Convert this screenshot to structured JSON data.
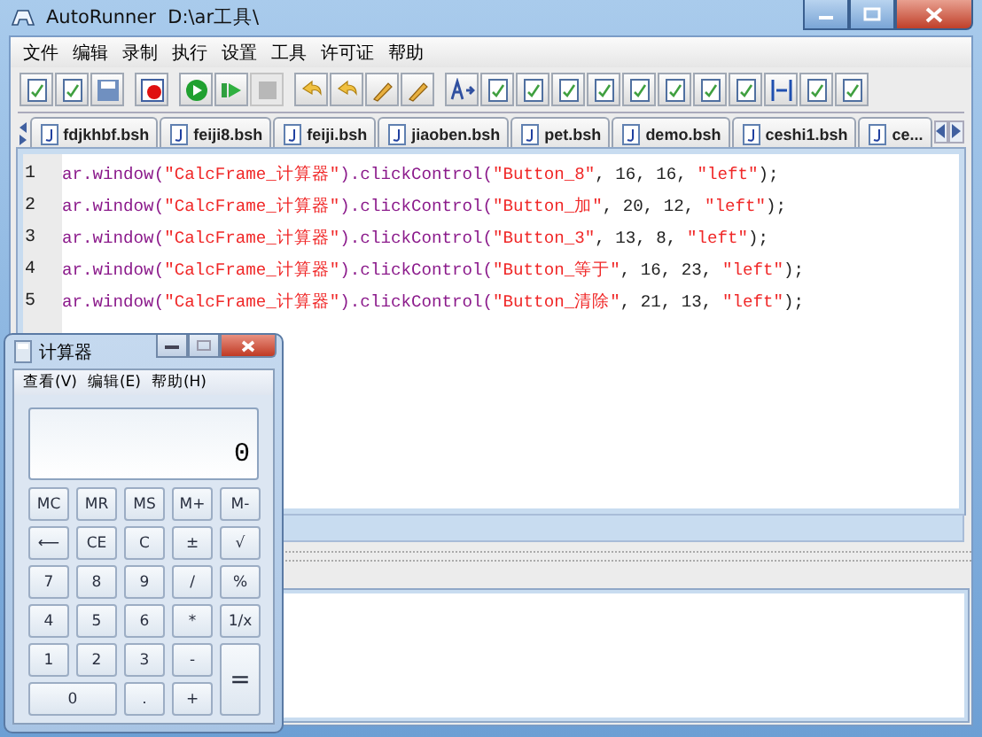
{
  "window": {
    "title": "AutoRunner  D:\\ar工具\\"
  },
  "menu": [
    "文件",
    "编辑",
    "录制",
    "执行",
    "设置",
    "工具",
    "许可证",
    "帮助"
  ],
  "toolbar": [
    {
      "buttons": [
        {
          "disabled": false
        },
        {
          "disabled": false
        },
        {
          "disabled": false
        }
      ]
    },
    {
      "buttons": [
        {
          "disabled": false
        }
      ]
    },
    {
      "buttons": [
        {
          "disabled": false
        },
        {
          "disabled": false
        },
        {
          "disabled": true
        }
      ]
    },
    {
      "buttons": [
        {
          "disabled": false
        },
        {
          "disabled": false
        },
        {
          "disabled": false
        },
        {
          "disabled": false
        }
      ]
    },
    {
      "buttons": [
        {
          "disabled": false
        },
        {
          "disabled": false
        },
        {
          "disabled": false
        },
        {
          "disabled": false
        },
        {
          "disabled": false
        },
        {
          "disabled": false
        },
        {
          "disabled": false
        },
        {
          "disabled": false
        },
        {
          "disabled": false
        },
        {
          "disabled": false
        },
        {
          "disabled": false
        },
        {
          "disabled": false
        }
      ]
    }
  ],
  "tabs": [
    "fdjkhbf.bsh",
    "feiji8.bsh",
    "feiji.bsh",
    "jiaoben.bsh",
    "pet.bsh",
    "demo.bsh",
    "ceshi1.bsh",
    "ce..."
  ],
  "editor": {
    "lines": [
      {
        "number": "1",
        "segments": [
          {
            "kind": "call",
            "text": "ar.window("
          },
          {
            "kind": "string",
            "text": "\"CalcFrame_计算器\""
          },
          {
            "kind": "call",
            "text": ").clickControl("
          },
          {
            "kind": "string",
            "text": "\"Button_8\""
          },
          {
            "kind": "plain",
            "text": ", 16, 16, "
          },
          {
            "kind": "string",
            "text": "\"left\""
          },
          {
            "kind": "plain",
            "text": ");"
          }
        ]
      },
      {
        "number": "2",
        "segments": [
          {
            "kind": "call",
            "text": "ar.window("
          },
          {
            "kind": "string",
            "text": "\"CalcFrame_计算器\""
          },
          {
            "kind": "call",
            "text": ").clickControl("
          },
          {
            "kind": "string",
            "text": "\"Button_加\""
          },
          {
            "kind": "plain",
            "text": ", 20, 12, "
          },
          {
            "kind": "string",
            "text": "\"left\""
          },
          {
            "kind": "plain",
            "text": ");"
          }
        ]
      },
      {
        "number": "3",
        "segments": [
          {
            "kind": "call",
            "text": "ar.window("
          },
          {
            "kind": "string",
            "text": "\"CalcFrame_计算器\""
          },
          {
            "kind": "call",
            "text": ").clickControl("
          },
          {
            "kind": "string",
            "text": "\"Button_3\""
          },
          {
            "kind": "plain",
            "text": ", 13, 8, "
          },
          {
            "kind": "string",
            "text": "\"left\""
          },
          {
            "kind": "plain",
            "text": ");"
          }
        ]
      },
      {
        "number": "4",
        "segments": [
          {
            "kind": "call",
            "text": "ar.window("
          },
          {
            "kind": "string",
            "text": "\"CalcFrame_计算器\""
          },
          {
            "kind": "call",
            "text": ").clickControl("
          },
          {
            "kind": "string",
            "text": "\"Button_等于\""
          },
          {
            "kind": "plain",
            "text": ", 16, 23, "
          },
          {
            "kind": "string",
            "text": "\"left\""
          },
          {
            "kind": "plain",
            "text": ");"
          }
        ]
      },
      {
        "number": "5",
        "segments": [
          {
            "kind": "call",
            "text": "ar.window("
          },
          {
            "kind": "string",
            "text": "\"CalcFrame_计算器\""
          },
          {
            "kind": "call",
            "text": ").clickControl("
          },
          {
            "kind": "string",
            "text": "\"Button_清除\""
          },
          {
            "kind": "plain",
            "text": ", 21, 13, "
          },
          {
            "kind": "string",
            "text": "\"left\""
          },
          {
            "kind": "plain",
            "text": ");"
          }
        ]
      }
    ]
  },
  "calculator": {
    "title": "计算器",
    "menu": [
      "查看(V)",
      "编辑(E)",
      "帮助(H)"
    ],
    "display": "0",
    "keys": [
      {
        "label": "MC",
        "kind": "normal"
      },
      {
        "label": "MR",
        "kind": "normal"
      },
      {
        "label": "MS",
        "kind": "normal"
      },
      {
        "label": "M+",
        "kind": "normal"
      },
      {
        "label": "M-",
        "kind": "normal"
      },
      {
        "label": "⟵",
        "kind": "normal"
      },
      {
        "label": "CE",
        "kind": "normal"
      },
      {
        "label": "C",
        "kind": "normal"
      },
      {
        "label": "±",
        "kind": "normal"
      },
      {
        "label": "√",
        "kind": "normal"
      },
      {
        "label": "7",
        "kind": "normal"
      },
      {
        "label": "8",
        "kind": "normal"
      },
      {
        "label": "9",
        "kind": "normal"
      },
      {
        "label": "/",
        "kind": "normal"
      },
      {
        "label": "%",
        "kind": "normal"
      },
      {
        "label": "4",
        "kind": "normal"
      },
      {
        "label": "5",
        "kind": "normal"
      },
      {
        "label": "6",
        "kind": "normal"
      },
      {
        "label": "*",
        "kind": "normal"
      },
      {
        "label": "1/x",
        "kind": "normal"
      },
      {
        "label": "1",
        "kind": "normal"
      },
      {
        "label": "2",
        "kind": "normal"
      },
      {
        "label": "3",
        "kind": "normal"
      },
      {
        "label": "-",
        "kind": "normal"
      },
      {
        "label": "=",
        "kind": "tall"
      },
      {
        "label": "0",
        "kind": "wide"
      },
      {
        "label": ".",
        "kind": "normal"
      },
      {
        "label": "+",
        "kind": "normal"
      }
    ]
  }
}
